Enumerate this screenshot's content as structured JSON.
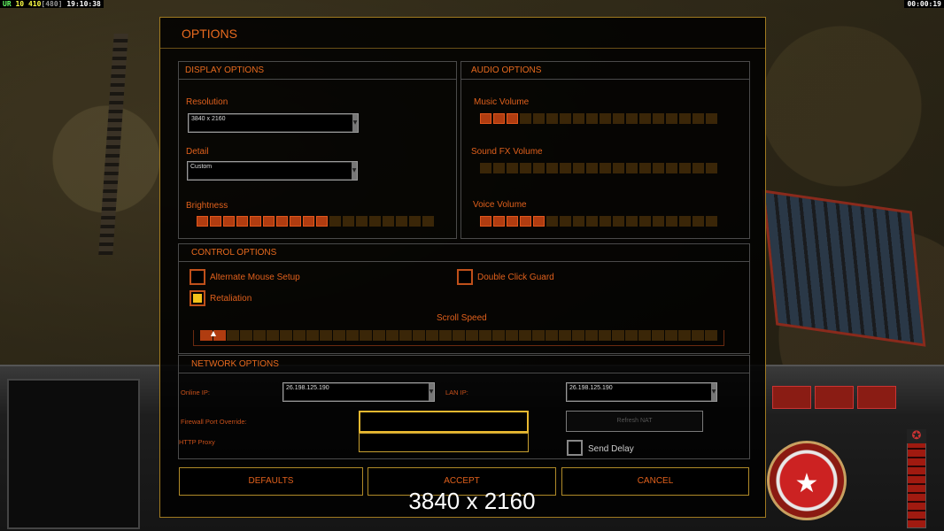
{
  "hud": {
    "left_prefix": "UR",
    "left_a": "10",
    "left_b": "410",
    "left_c": "[480]",
    "left_time": "19:10:38",
    "right_time": "00:00:19"
  },
  "dialog": {
    "title": "OPTIONS",
    "display": {
      "heading": "DISPLAY OPTIONS",
      "resolution_label": "Resolution",
      "resolution_value": "3840 x 2160",
      "detail_label": "Detail",
      "detail_value": "Custom",
      "brightness_label": "Brightness",
      "brightness_level": 10,
      "brightness_steps": 18
    },
    "audio": {
      "heading": "AUDIO OPTIONS",
      "music_label": "Music Volume",
      "music_level": 3,
      "sfx_label": "Sound FX Volume",
      "sfx_level": 0,
      "voice_label": "Voice Volume",
      "voice_level": 5,
      "steps": 18
    },
    "control": {
      "heading": "CONTROL OPTIONS",
      "alt_mouse_label": "Alternate Mouse Setup",
      "alt_mouse_checked": false,
      "double_click_label": "Double Click Guard",
      "double_click_checked": false,
      "retaliation_label": "Retaliation",
      "retaliation_checked": true,
      "scroll_label": "Scroll Speed",
      "scroll_level": 2,
      "scroll_steps": 39
    },
    "network": {
      "heading": "NETWORK OPTIONS",
      "online_ip_label": "Online IP:",
      "online_ip_value": "26.198.125.190",
      "lan_ip_label": "LAN IP:",
      "lan_ip_value": "26.198.125.190",
      "firewall_label": "Firewall Port Override:",
      "firewall_value": "",
      "proxy_label": "HTTP Proxy",
      "proxy_value": "",
      "refresh_label": "Refresh NAT",
      "send_delay_label": "Send Delay",
      "send_delay_checked": false
    },
    "buttons": {
      "defaults": "DEFAULTS",
      "accept": "ACCEPT",
      "cancel": "CANCEL"
    }
  },
  "caption": "3840 x 2160",
  "colors": {
    "accent": "#e0601c",
    "frame": "#a07a20",
    "slider_on": "#b03c10",
    "slider_off": "#3a2608",
    "check_fill": "#f2c21a"
  }
}
